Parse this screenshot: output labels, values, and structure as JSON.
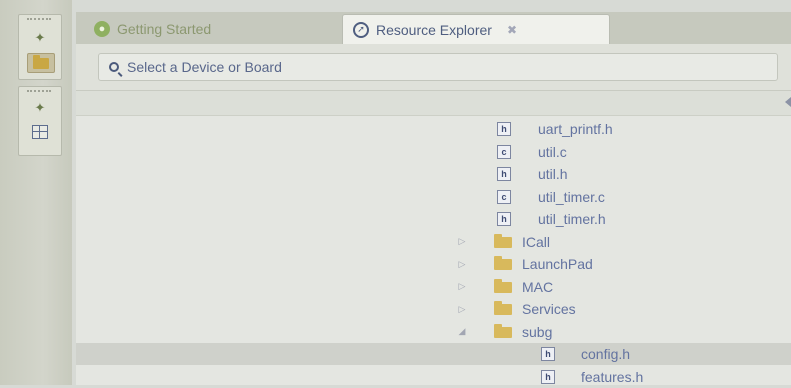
{
  "tabs": [
    {
      "label": "Getting Started",
      "icon": "getting-started-icon",
      "active": false
    },
    {
      "label": "Resource Explorer",
      "icon": "compass-icon",
      "active": true,
      "close": "✖"
    }
  ],
  "search": {
    "placeholder": "Select a Device or Board"
  },
  "tree": {
    "rows": [
      {
        "label": "uart_printf.h",
        "type": "file",
        "ext": "h"
      },
      {
        "label": "util.c",
        "type": "file",
        "ext": "c"
      },
      {
        "label": "util.h",
        "type": "file",
        "ext": "h"
      },
      {
        "label": "util_timer.c",
        "type": "file",
        "ext": "c"
      },
      {
        "label": "util_timer.h",
        "type": "file",
        "ext": "h"
      },
      {
        "label": "ICall",
        "type": "folder",
        "expanded": false
      },
      {
        "label": "LaunchPad",
        "type": "folder",
        "expanded": false
      },
      {
        "label": "MAC",
        "type": "folder",
        "expanded": false
      },
      {
        "label": "Services",
        "type": "folder",
        "expanded": false
      },
      {
        "label": "subg",
        "type": "folder",
        "expanded": true
      },
      {
        "label": "config.h",
        "type": "file",
        "ext": "h",
        "selected": true
      },
      {
        "label": "features.h",
        "type": "file",
        "ext": "h"
      }
    ]
  },
  "colors": {
    "text": "#5c6b8c",
    "folder": "#d8b95c",
    "selection": "#cfd1cb"
  }
}
